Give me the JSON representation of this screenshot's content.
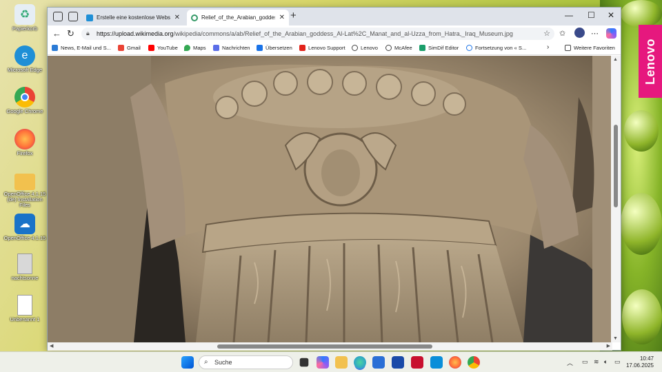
{
  "desktop": {
    "icons": [
      {
        "label": "Papierkorb",
        "icon": "recycle-bin-icon",
        "color": "#e6eef5"
      },
      {
        "label": "Microsoft Edge",
        "icon": "edge-icon",
        "color": "#1f8fd6"
      },
      {
        "label": "Google Chrome",
        "icon": "chrome-icon",
        "color": "#e8453c"
      },
      {
        "label": "Firefox",
        "icon": "firefox-icon",
        "color": "#ff7139"
      },
      {
        "label": "OpenOffice 4.1.15 (de) Installation Files",
        "icon": "folder-icon",
        "color": "#f2c14e"
      },
      {
        "label": "OpenOffice 4.1.15",
        "icon": "openoffice-icon",
        "color": "#1a73c8"
      },
      {
        "label": "nachtsonne",
        "icon": "document-image-icon",
        "color": "#c9c9c9"
      },
      {
        "label": "Unbenannt 1",
        "icon": "document-icon",
        "color": "#ffffff"
      }
    ],
    "brand_badge": "Lenovo",
    "brand_color": "#e6187e"
  },
  "browser": {
    "tabs": [
      {
        "title": "Erstelle eine kostenlose Website m",
        "icon": "edge-page-icon",
        "active": false
      },
      {
        "title": "Relief_of_the_Arabian_goddess_Al-",
        "icon": "wikimedia-icon",
        "active": true
      }
    ],
    "url_host": "https://upload.wikimedia.org",
    "url_path": "/wikipedia/commons/a/ab/Relief_of_the_Arabian_goddess_Al-Lat%2C_Manat_and_al-Uzza_from_Hatra,_Iraq_Museum.jpg",
    "favorites": [
      {
        "label": "News, E-Mail und S...",
        "color": "#2b7bd6"
      },
      {
        "label": "Gmail",
        "color": "#ea4335"
      },
      {
        "label": "YouTube",
        "color": "#ff0000"
      },
      {
        "label": "Maps",
        "color": "#34a853"
      },
      {
        "label": "Nachrichten",
        "color": "#5b6ee8"
      },
      {
        "label": "Übersetzen",
        "color": "#1a73e8"
      },
      {
        "label": "Lenovo Support",
        "color": "#e2231a"
      },
      {
        "label": "Lenovo",
        "color": "#444444"
      },
      {
        "label": "McAfee",
        "color": "#444444"
      },
      {
        "label": "SimDif Editor",
        "color": "#1a9e6a"
      },
      {
        "label": "Fortsetzung von « S...",
        "color": "#1a73e8"
      }
    ],
    "more_favorites": "Weitere Favoriten"
  },
  "taskbar": {
    "search_placeholder": "Suche",
    "time": "10:47",
    "date": "17.06.2025",
    "apps": [
      {
        "icon": "task-view-icon",
        "color": "#333333"
      },
      {
        "icon": "copilot-icon",
        "color": "#7b61ff"
      },
      {
        "icon": "file-explorer-icon",
        "color": "#f2c14e"
      },
      {
        "icon": "edge-icon",
        "color": "#1f8fd6"
      },
      {
        "icon": "store-icon",
        "color": "#2a6fd6"
      },
      {
        "icon": "lenovo-vantage-icon",
        "color": "#1a4aa8"
      },
      {
        "icon": "mcafee-icon",
        "color": "#c8102e"
      },
      {
        "icon": "app-blue-icon",
        "color": "#0a8ed9"
      },
      {
        "icon": "firefox-icon",
        "color": "#ff7139"
      },
      {
        "icon": "chrome-icon",
        "color": "#e8453c"
      }
    ]
  }
}
